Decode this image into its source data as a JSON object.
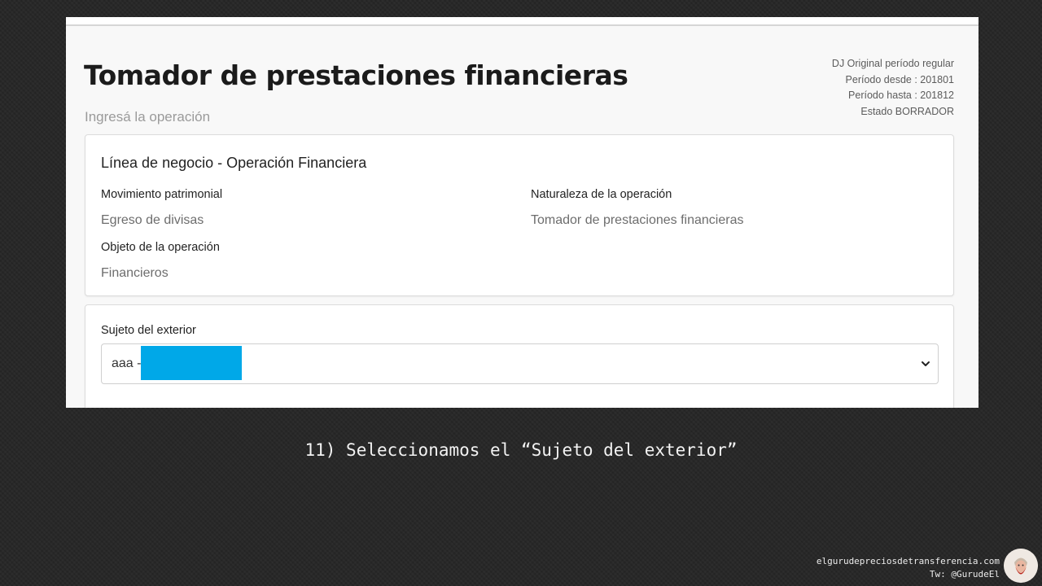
{
  "header": {
    "title": "Tomador de prestaciones financieras",
    "subtitle": "Ingresá la operación",
    "meta": [
      "DJ Original período regular",
      "Período desde : 201801",
      "Período hasta : 201812",
      "Estado BORRADOR"
    ]
  },
  "business_card": {
    "heading": "Línea de negocio - Operación Financiera",
    "fields": [
      {
        "label": "Movimiento patrimonial",
        "value": "Egreso de divisas"
      },
      {
        "label": "Naturaleza de la operación",
        "value": "Tomador de prestaciones financieras"
      },
      {
        "label": "Objeto de la operación",
        "value": "Financieros"
      }
    ]
  },
  "subject_card": {
    "label": "Sujeto del exterior",
    "selected_value": "aaa -"
  },
  "caption": "11) Seleccionamos el “Sujeto del exterior”",
  "credit": {
    "site": "elgurudepreciosdetransferencia.com",
    "twitter": "Tw: @GurudeEl"
  },
  "colors": {
    "redaction": "#00a8e8",
    "slide_background": "#262626"
  }
}
